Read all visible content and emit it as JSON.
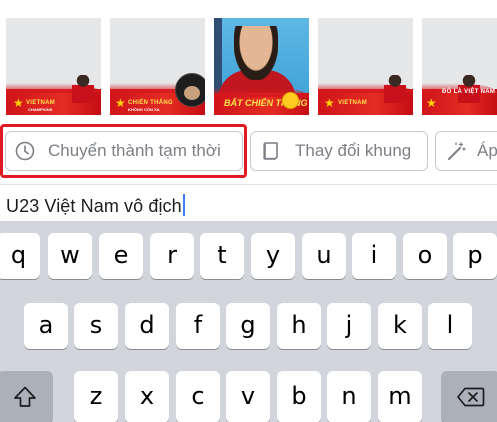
{
  "frames": {
    "items": [
      {
        "label": "VIETNAM",
        "sub": "CHAMPIONS"
      },
      {
        "label": "CHIẾN THẮNG",
        "sub": "KHÔNG CÒN XA"
      },
      {
        "label": "BẤT CHIẾN THẮNG",
        "sub": ""
      },
      {
        "label": "VIETNAM",
        "sub": ""
      },
      {
        "label": "ĐÓ LÀ VIỆT NAM",
        "sub": ""
      }
    ]
  },
  "toolbar": {
    "temporary_label": "Chuyển thành tạm thời",
    "change_frame_label": "Thay đổi khung",
    "apply_label": "Áp"
  },
  "input": {
    "value": "U23 Việt Nam vô địch"
  },
  "keyboard": {
    "row1": [
      "q",
      "w",
      "e",
      "r",
      "t",
      "y",
      "u",
      "i",
      "o",
      "p"
    ],
    "row2": [
      "a",
      "s",
      "d",
      "f",
      "g",
      "h",
      "j",
      "k",
      "l"
    ],
    "row3": [
      "z",
      "x",
      "c",
      "v",
      "b",
      "n",
      "m"
    ],
    "shift_icon": "shift-icon",
    "backspace_icon": "backspace-icon"
  },
  "colors": {
    "highlight": "#e01922",
    "caret": "#3a7ff6",
    "keyboard_bg": "#d2d5db"
  }
}
